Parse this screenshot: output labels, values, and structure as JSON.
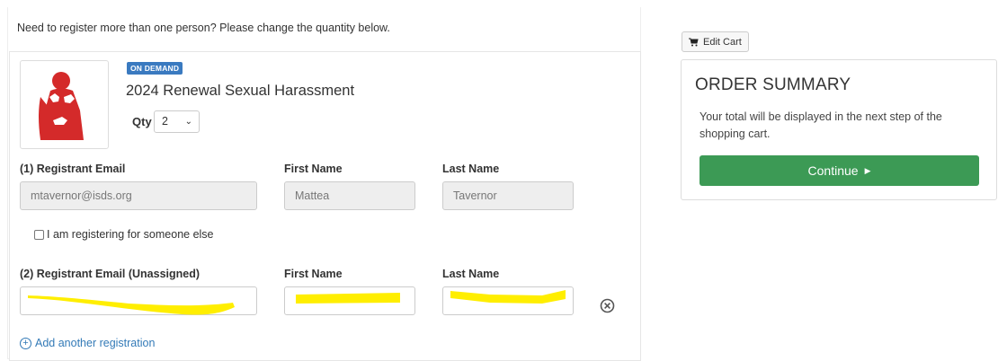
{
  "notice": "Need to register more than one person? Please change the quantity below.",
  "item": {
    "badge": "ON DEMAND",
    "title": "2024 Renewal Sexual Harassment",
    "qty_label": "Qty",
    "qty_value": "2",
    "thumbnail_icon": "person-hands-icon"
  },
  "registrants": [
    {
      "email_label": "(1) Registrant Email",
      "first_label": "First Name",
      "last_label": "Last Name",
      "email": "mtavernor@isds.org",
      "first": "Mattea",
      "last": "Tavernor",
      "checkbox_label": "I am registering for someone else"
    },
    {
      "email_label": "(2) Registrant Email (Unassigned)",
      "first_label": "First Name",
      "last_label": "Last Name",
      "email": "",
      "first": "",
      "last": ""
    }
  ],
  "add_registration": "Add another registration",
  "cart": {
    "edit_label": "Edit Cart",
    "summary_title": "ORDER SUMMARY",
    "summary_text": "Your total will be displayed in the next step of the shopping cart.",
    "continue_label": "Continue"
  },
  "colors": {
    "badge": "#3a7ac0",
    "continue": "#3c9a55",
    "link": "#337ab7",
    "redaction": "#ffee00"
  }
}
